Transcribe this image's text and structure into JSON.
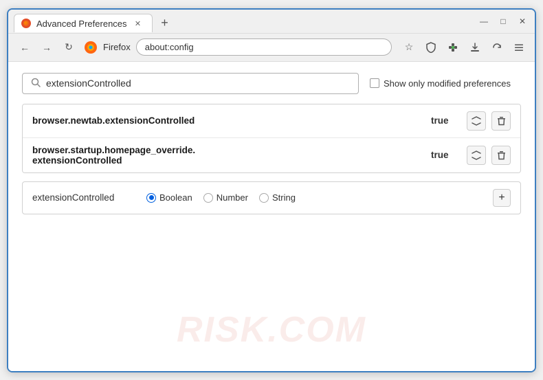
{
  "window": {
    "title": "Advanced Preferences",
    "new_tab_btn": "+",
    "close_btn": "✕",
    "minimize_btn": "—",
    "maximize_btn": "□"
  },
  "nav": {
    "back_tooltip": "Back",
    "forward_tooltip": "Forward",
    "reload_tooltip": "Reload",
    "browser_name": "Firefox",
    "address": "about:config",
    "bookmark_icon": "☆",
    "shield_icon": "🛡",
    "extension_icon": "🧩",
    "downloads_icon": "📥",
    "sync_icon": "⟳",
    "menu_icon": "☰"
  },
  "search": {
    "placeholder": "extensionControlled",
    "value": "extensionControlled",
    "show_modified_label": "Show only modified preferences"
  },
  "table": {
    "rows": [
      {
        "name": "browser.newtab.extensionControlled",
        "value": "true"
      },
      {
        "name": "browser.startup.homepage_override.\nextensionControlled",
        "name_line1": "browser.startup.homepage_override.",
        "name_line2": "extensionControlled",
        "value": "true",
        "multiline": true
      }
    ]
  },
  "new_pref": {
    "name": "extensionControlled",
    "types": [
      {
        "id": "boolean",
        "label": "Boolean",
        "selected": true
      },
      {
        "id": "number",
        "label": "Number",
        "selected": false
      },
      {
        "id": "string",
        "label": "String",
        "selected": false
      }
    ],
    "add_btn": "+"
  },
  "watermark": "RISK.COM"
}
